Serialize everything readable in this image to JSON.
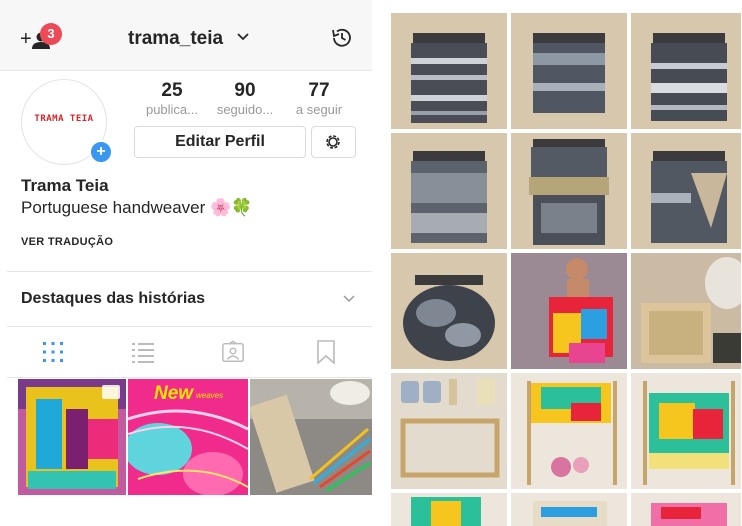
{
  "header": {
    "add_plus": "+",
    "notification_count": "3",
    "username": "trama_teia"
  },
  "profile": {
    "avatar_text": "TRAMA TEIA",
    "avatar_add": "+",
    "stats": [
      {
        "value": "25",
        "label": "publica..."
      },
      {
        "value": "90",
        "label": "seguido..."
      },
      {
        "value": "77",
        "label": "a seguir"
      }
    ],
    "edit_button": "Editar Perfil",
    "name": "Trama Teia",
    "bio": "Portuguese handweaver 🌸🍀",
    "translate_link": "VER TRADUÇÃO",
    "highlights_label": "Destaques das histórias"
  },
  "tabs": [
    "grid-icon",
    "list-icon",
    "tagged-icon",
    "saved-icon"
  ],
  "posts_preview": {
    "new_label": "New",
    "new_sub": "weaves"
  },
  "colors": {
    "notification_badge": "#ed4956",
    "avatar_add": "#3897f0",
    "avatar_text": "#d6252b",
    "active_tab": "#3897f0"
  }
}
